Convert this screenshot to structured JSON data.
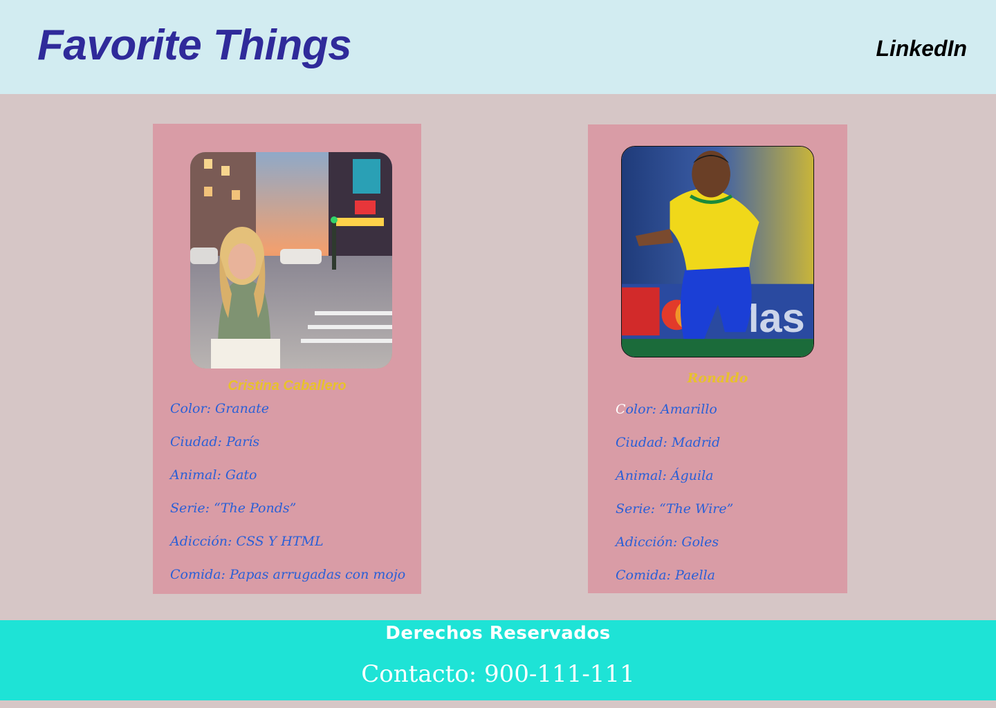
{
  "header": {
    "title": "Favorite Things",
    "link": "LinkedIn"
  },
  "cards": [
    {
      "name": "Cristina Caballero",
      "facts": [
        "Color: Granate",
        "Ciudad: París",
        "Animal: Gato",
        "Serie: “The Ponds”",
        "Adicción: CSS Y HTML",
        "Comida: Papas arrugadas con mojo"
      ]
    },
    {
      "name": "Ronaldo",
      "first_fact_initial": "C",
      "first_fact_rest": "olor: Amarillo",
      "facts": [
        "Color: Amarillo",
        "Ciudad: Madrid",
        "Animal: Águila",
        "Serie: “The Wire”",
        "Adicción: Goles",
        "Comida: Paella"
      ]
    }
  ],
  "footer": {
    "rights": "Derechos Reservados",
    "contact": "Contacto: 900-111-111"
  },
  "colors": {
    "header_bg": "#d2ecf1",
    "page_bg": "#d6c6c6",
    "card_bg": "#d99ca6",
    "title": "#2f2a9a",
    "name": "#e8c12c",
    "fact_text": "#2a5fd6",
    "footer_bg": "#1ee3d6"
  }
}
